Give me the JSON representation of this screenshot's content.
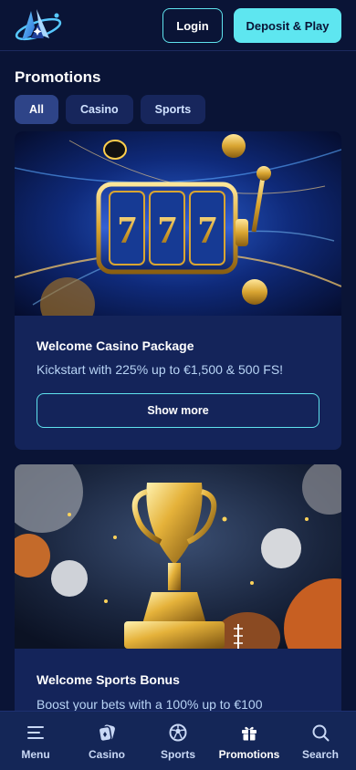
{
  "header": {
    "login_label": "Login",
    "deposit_label": "Deposit & Play",
    "accent_color": "#5ee6f0"
  },
  "page": {
    "title": "Promotions"
  },
  "filters": [
    {
      "label": "All",
      "active": true
    },
    {
      "label": "Casino",
      "active": false
    },
    {
      "label": "Sports",
      "active": false
    }
  ],
  "promotions": [
    {
      "title": "Welcome Casino Package",
      "description": "Kickstart with 225% up to €1,500 & 500 FS!",
      "button_label": "Show more",
      "image": "slot-machine-777"
    },
    {
      "title": "Welcome Sports Bonus",
      "description": "Boost your bets with a 100% up to €100",
      "image": "golden-trophy-sports-balls"
    }
  ],
  "bottom_nav": [
    {
      "label": "Menu",
      "icon": "menu-icon",
      "active": false
    },
    {
      "label": "Casino",
      "icon": "casino-icon",
      "active": false
    },
    {
      "label": "Sports",
      "icon": "sports-icon",
      "active": false
    },
    {
      "label": "Promotions",
      "icon": "gift-icon",
      "active": true
    },
    {
      "label": "Search",
      "icon": "search-icon",
      "active": false
    }
  ]
}
